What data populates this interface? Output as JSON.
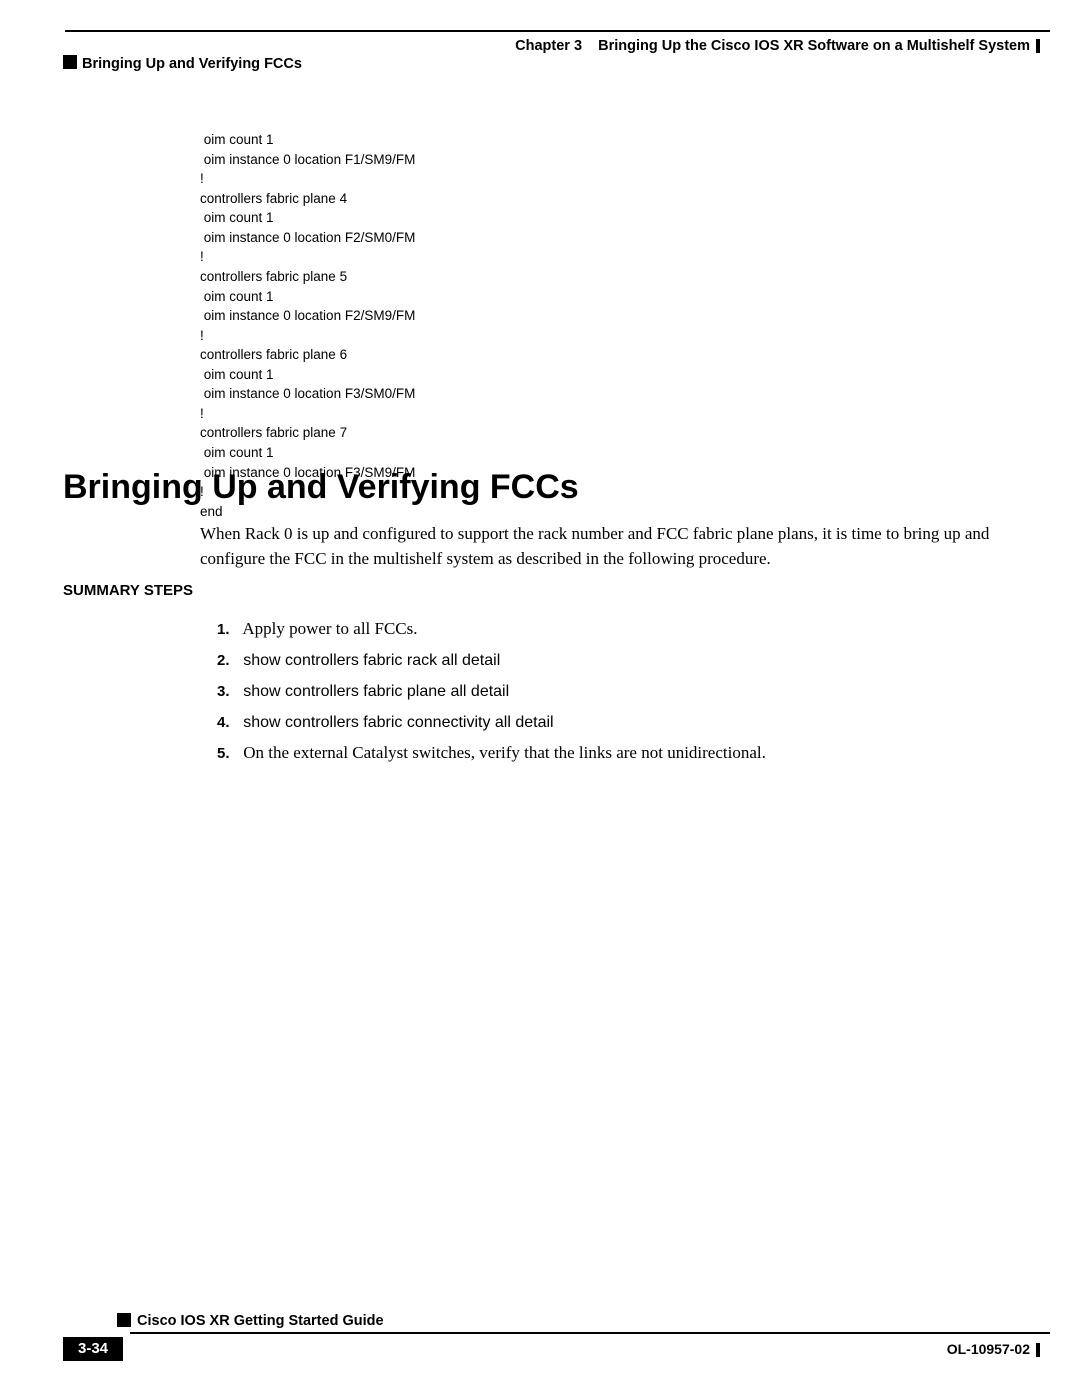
{
  "header": {
    "chapter_label": "Chapter 3",
    "chapter_title": "Bringing Up the Cisco IOS XR Software on a Multishelf System",
    "section_title": "Bringing Up and Verifying FCCs"
  },
  "code_block": " oim count 1\n oim instance 0 location F1/SM9/FM\n!\ncontrollers fabric plane 4\n oim count 1\n oim instance 0 location F2/SM0/FM\n!\ncontrollers fabric plane 5\n oim count 1\n oim instance 0 location F2/SM9/FM\n!\ncontrollers fabric plane 6\n oim count 1\n oim instance 0 location F3/SM0/FM\n!\ncontrollers fabric plane 7\n oim count 1\n oim instance 0 location F3/SM9/FM\n!\nend",
  "h1": "Bringing Up and Verifying FCCs",
  "intro": "When Rack 0 is up and configured to support the rack number and FCC fabric plane plans, it is time to bring up and configure the FCC in the multishelf system as described in the following procedure.",
  "summary_label": "SUMMARY STEPS",
  "steps": [
    {
      "num": "1.",
      "text": "Apply power to all FCCs.",
      "cmd": false
    },
    {
      "num": "2.",
      "text": "show controllers fabric rack all detail",
      "cmd": true
    },
    {
      "num": "3.",
      "text": "show controllers fabric plane all detail",
      "cmd": true
    },
    {
      "num": "4.",
      "text": "show controllers fabric connectivity all detail",
      "cmd": true
    },
    {
      "num": "5.",
      "text": "On the external Catalyst switches, verify that the links are not unidirectional.",
      "cmd": false
    }
  ],
  "footer": {
    "guide_title": "Cisco IOS XR Getting Started Guide",
    "page_number": "3-34",
    "doc_id": "OL-10957-02"
  }
}
